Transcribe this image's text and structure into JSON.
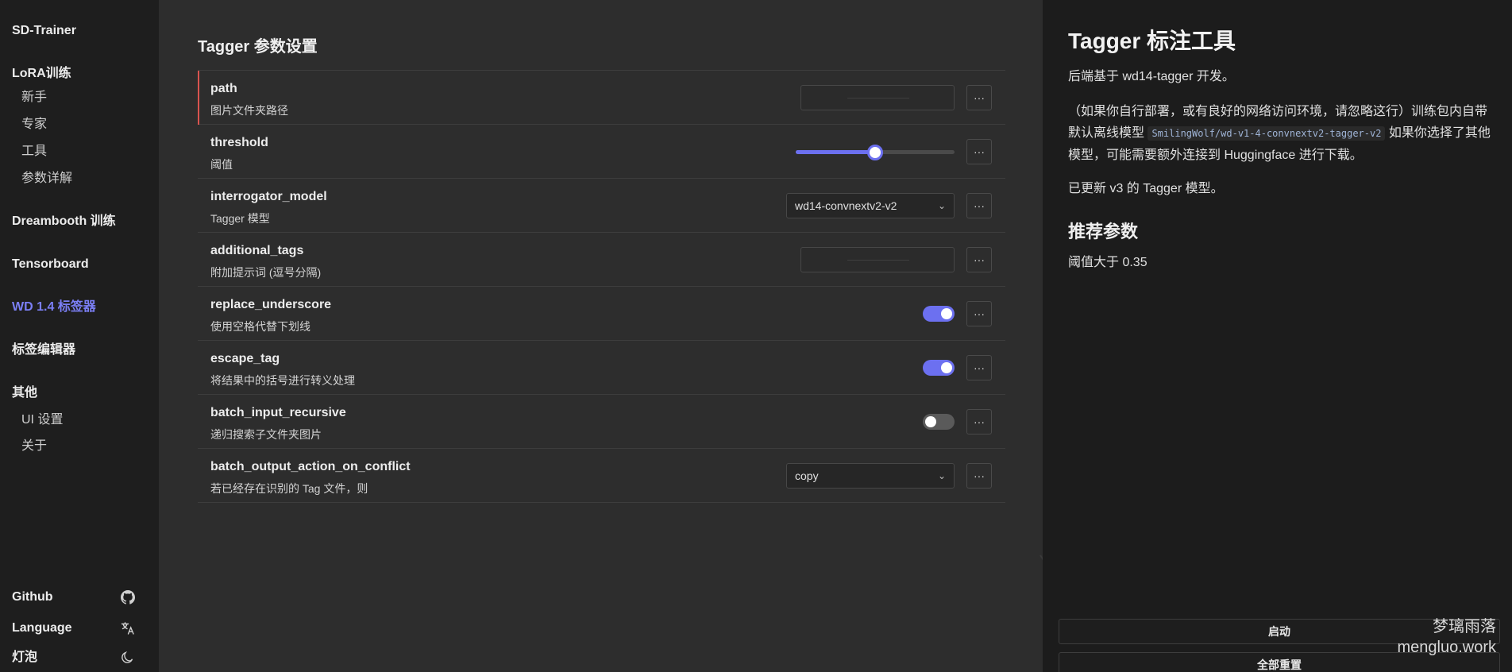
{
  "sidebar": {
    "title": "SD-Trainer",
    "lora": {
      "label": "LoRA训练",
      "items": [
        "新手",
        "专家",
        "工具",
        "参数详解"
      ]
    },
    "dreambooth": "Dreambooth 训练",
    "tensorboard": "Tensorboard",
    "wd_tagger": "WD 1.4 标签器",
    "tag_editor": "标签编辑器",
    "other": {
      "label": "其他",
      "items": [
        "UI 设置",
        "关于"
      ]
    },
    "bottom": {
      "github": "Github",
      "language": "Language",
      "theme": "灯泡"
    }
  },
  "main": {
    "title": "Tagger 参数设置",
    "more_label": "···",
    "params": [
      {
        "name": "path",
        "desc": "图片文件夹路径",
        "control": "text"
      },
      {
        "name": "threshold",
        "desc": "阈值",
        "control": "slider",
        "value": 0.5
      },
      {
        "name": "interrogator_model",
        "desc": "Tagger 模型",
        "control": "select",
        "value": "wd14-convnextv2-v2"
      },
      {
        "name": "additional_tags",
        "desc": "附加提示词 (逗号分隔)",
        "control": "text"
      },
      {
        "name": "replace_underscore",
        "desc": "使用空格代替下划线",
        "control": "toggle",
        "value": true
      },
      {
        "name": "escape_tag",
        "desc": "将结果中的括号进行转义处理",
        "control": "toggle",
        "value": true
      },
      {
        "name": "batch_input_recursive",
        "desc": "递归搜索子文件夹图片",
        "control": "toggle",
        "value": false
      },
      {
        "name": "batch_output_action_on_conflict",
        "desc": "若已经存在识别的 Tag 文件，则",
        "control": "select",
        "value": "copy"
      }
    ]
  },
  "right": {
    "title": "Tagger 标注工具",
    "p1": "后端基于 wd14-tagger 开发。",
    "p2_a": "（如果你自行部署，或有良好的网络访问环境，请忽略这行）训练包内自带默认离线模型 ",
    "p2_code": "SmilingWolf/wd-v1-4-convnextv2-tagger-v2",
    "p2_b": " 如果你选择了其他模型，可能需要额外连接到 Huggingface 进行下载。",
    "p3": "已更新 v3 的 Tagger 模型。",
    "h2": "推荐参数",
    "p4": "阈值大于 0.35",
    "start_button": "启动",
    "reset_button": "全部重置"
  },
  "watermark": {
    "line1": "梦璃雨落",
    "line2": "mengluo.work"
  },
  "colors": {
    "accent": "#6c70f0",
    "invalid": "#d9534f",
    "sidebar_bg": "#1e1e1e",
    "main_bg": "#2d2d2d",
    "right_bg": "#1c1c1c"
  }
}
